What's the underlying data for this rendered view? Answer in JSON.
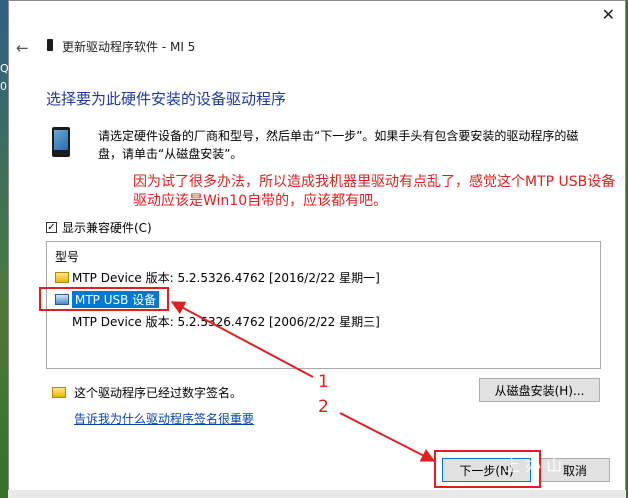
{
  "background": {
    "left_chars": [
      "Q",
      "0"
    ]
  },
  "window": {
    "title": "更新驱动程序软件 - MI 5",
    "close_symbol": "✕",
    "back_symbol": "←"
  },
  "main": {
    "heading": "选择要为此硬件安装的设备驱动程序",
    "instruction": "请选定硬件设备的厂商和型号，然后单击“下一步”。如果手头有包含要安装的驱动程序的磁盘，请单击“从磁盘安装”。",
    "annotation": "因为试了很多办法，所以造成我机器里驱动有点乱了，感觉这个MTP USB设备驱动应该是Win10自带的，应该都有吧。",
    "compat_checkbox": {
      "label": "显示兼容硬件(C)",
      "checked": true,
      "mark": "✓"
    },
    "list": {
      "header": "型号",
      "items": [
        "MTP Device 版本: 5.2.5326.4762 [2016/2/22 星期一]",
        "MTP USB 设备",
        "MTP Device 版本: 5.2.5326.4762 [2006/2/22 星期三]"
      ],
      "selected_index": 1
    },
    "signature_text": "这个驱动程序已经过数字签名。",
    "signature_link": "告诉我为什么驱动程序签名很重要",
    "disk_button": "从磁盘安装(H)...",
    "next_button": "下一步(N)",
    "cancel_button": "取消"
  },
  "annotations": {
    "num1": "1",
    "num2": "2",
    "watermark": "上 办 山"
  },
  "colors": {
    "accent": "#0078d7",
    "annotation_red": "#e02020",
    "heading_blue": "#1f3aa0"
  }
}
